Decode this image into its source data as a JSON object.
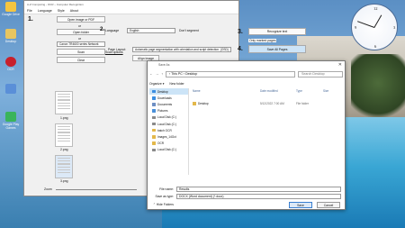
{
  "desktop": {
    "icons": [
      {
        "label": "Google\nDrive",
        "color": "#f4c542"
      },
      {
        "label": "Desktop",
        "color": "#e7c560"
      },
      {
        "label": "OCR",
        "color": "#c8202c"
      },
      {
        "label": "",
        "color": "#5a8fd8"
      },
      {
        "label": "Google Play\nGames",
        "color": "#3ab45b"
      }
    ]
  },
  "app": {
    "title": "A-Z Computing - OCR – Computer Recognition",
    "menu": [
      "File",
      "Language",
      "Style",
      "About"
    ],
    "step1": "1.",
    "open_image": "Open image or PDF",
    "or1": "or",
    "open_folder": "Open folder",
    "or2": "or",
    "scanner": "Canon TR4600 series Network",
    "scan": "Scan",
    "scan_options": "Scan options",
    "clear": "Clear",
    "step2": "2.",
    "language_label": "Language",
    "language_value": "English",
    "detect_regions": "Don't segment",
    "page_layout_label": "Page Layout:",
    "page_layout_value": "Automatic page segmentation with orientation and script detection. (OSD)",
    "align_image": "Align Image",
    "step3": "3.",
    "recognize": "Recognize text",
    "only_marked": "Only marked pages",
    "step4": "4.",
    "save_pages": "Save All Pages",
    "page_labels": [
      "1.png",
      "2.png",
      "3.png"
    ],
    "zoom_label": "Zoom"
  },
  "dialog": {
    "title": "Save As",
    "close": "✕",
    "breadcrumb": "›  This PC  ›  Desktop",
    "search_placeholder": "Search Desktop",
    "organize": "Organize ▾",
    "new_folder": "New folder",
    "nav": [
      {
        "label": "Desktop",
        "color": "#3a8de0",
        "selected": true
      },
      {
        "label": "Downloads",
        "color": "#3a8de0",
        "selected": false
      },
      {
        "label": "Documents",
        "color": "#6e8fc4",
        "selected": false
      },
      {
        "label": "Pictures",
        "color": "#4a90d9",
        "selected": false
      },
      {
        "label": "Local Disk (C:)",
        "color": "#8a8a8a",
        "selected": false
      },
      {
        "label": "Local Disk (C:)",
        "color": "#8a8a8a",
        "selected": false
      },
      {
        "label": "batch OCR",
        "color": "#e3b84a",
        "selected": false
      },
      {
        "label": "Images_14Oct",
        "color": "#e3b84a",
        "selected": false
      },
      {
        "label": "OCR",
        "color": "#e3b84a",
        "selected": false
      },
      {
        "label": "Local Disk (C:)",
        "color": "#8a8a8a",
        "selected": false
      }
    ],
    "columns": [
      "Name",
      "Date modified",
      "Type",
      "Size"
    ],
    "rows": [
      {
        "name": "Desktop",
        "date": "5/12/2022 7:00 AM",
        "type": "File folder",
        "size": ""
      }
    ],
    "file_name_label": "File name:",
    "file_name_value": "Results",
    "save_type_label": "Save as type:",
    "save_type_value": "DOCX (Word document) (*.docx)",
    "hide_folders": "⌃  Hide Folders",
    "save": "Save",
    "cancel": "Cancel"
  }
}
